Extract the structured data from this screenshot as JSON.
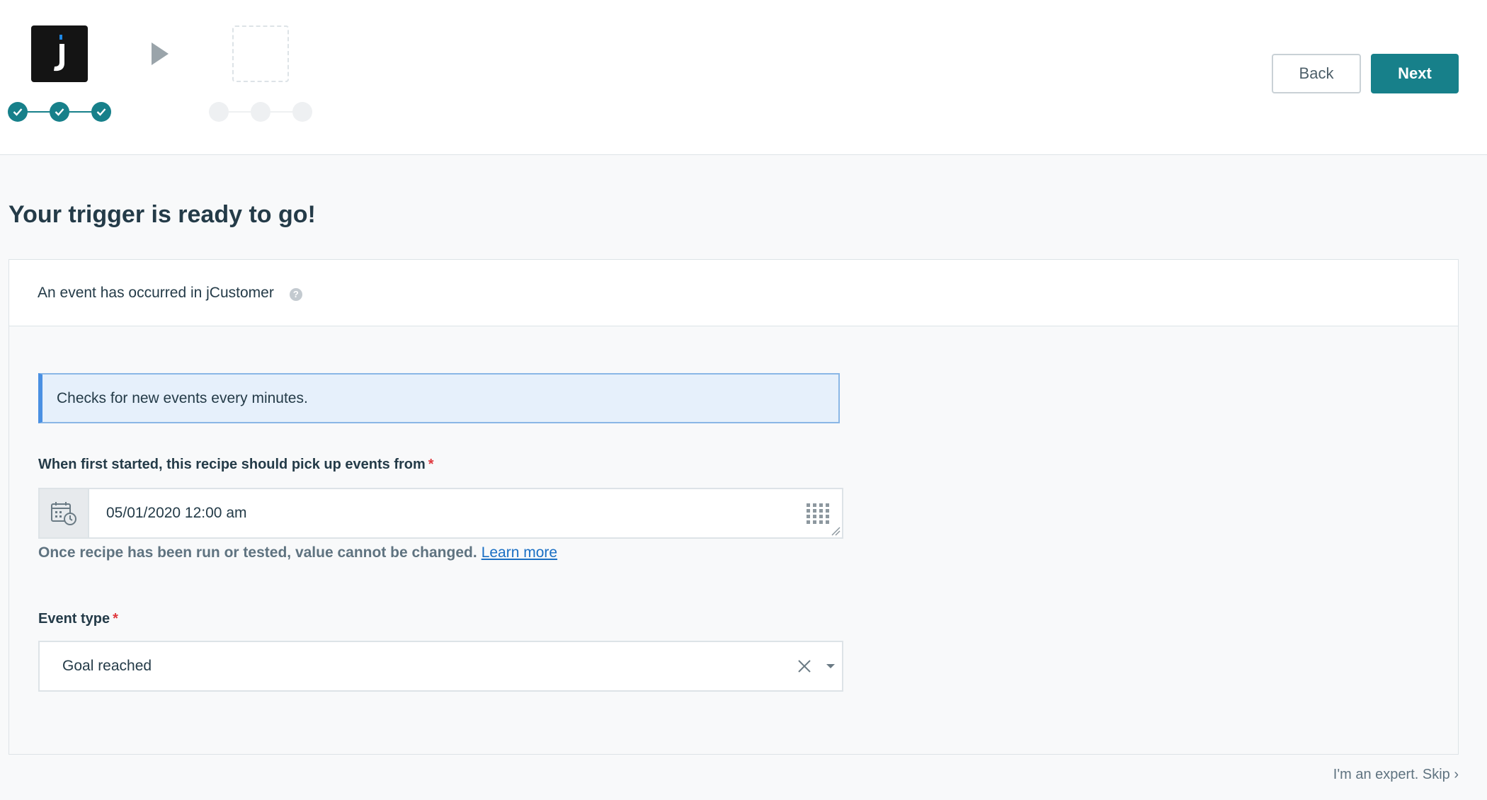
{
  "header": {
    "logo_letter": "j",
    "logo_accent_color": "#1e88e5",
    "arrow_icon": "play-arrow-icon",
    "source_steps": [
      "done",
      "done",
      "done"
    ],
    "action_steps": [
      "todo",
      "todo",
      "todo"
    ],
    "back_label": "Back",
    "next_label": "Next"
  },
  "main": {
    "title": "Your trigger is ready to go!",
    "card": {
      "trigger_name": "An event has occurred in jCustomer",
      "help_icon": "?",
      "info_text": "Checks for new events every minutes.",
      "since_field": {
        "label": "When first started, this recipe should pick up events from",
        "required": "*",
        "value": "05/01/2020 12:00 am",
        "hint": "Once recipe has been run or tested, value cannot be changed.",
        "hint_link": "Learn more"
      },
      "event_type_field": {
        "label": "Event type",
        "required": "*",
        "value": "Goal reached"
      }
    }
  },
  "footer": {
    "skip_label": "I'm an expert. Skip ›"
  },
  "colors": {
    "accent": "#17808a",
    "link": "#1a6fc4",
    "required": "#e0393e"
  }
}
